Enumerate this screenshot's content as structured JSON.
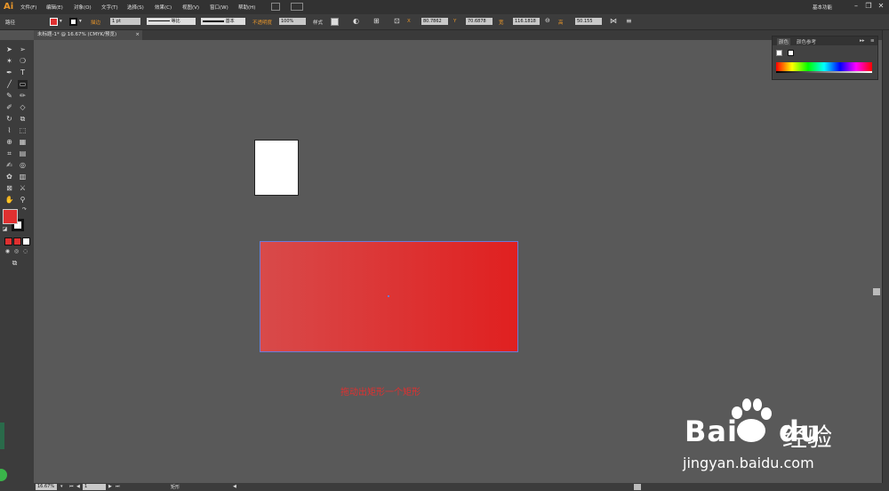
{
  "menubar": {
    "logo": "Ai",
    "items": [
      "文件(F)",
      "编辑(E)",
      "对象(O)",
      "文字(T)",
      "选择(S)",
      "效果(C)",
      "视图(V)",
      "窗口(W)",
      "帮助(H)"
    ],
    "workspace": "基本功能"
  },
  "controlbar": {
    "object_type": "路径",
    "stroke_label": "描边",
    "stroke_weight": "1 pt",
    "profile_label": "等比",
    "brush_label": "基本",
    "opacity_label": "不透明度",
    "opacity_value": "100%",
    "style_label": "样式",
    "x_label": "X",
    "x_value": "80.7862",
    "y_label": "Y",
    "y_value": "70.6878",
    "w_label": "宽",
    "w_value": "116.1818",
    "h_label": "高",
    "h_value": "50.155",
    "fill_color": "#e03030"
  },
  "document": {
    "tab_title": "未标题-1* @ 16.67% (CMYK/预览)",
    "close": "×"
  },
  "canvas": {
    "annotation": "拖动出矩形一个矩形",
    "rect_color_start": "#d84a4a",
    "rect_color_end": "#e02020"
  },
  "colorpanel": {
    "tab1": "颜色",
    "tab2": "颜色参考"
  },
  "statusbar": {
    "zoom": "16.67%",
    "artboard": "1",
    "tool": "矩形"
  },
  "watermark": {
    "brand": "Bai",
    "brand2": "du",
    "cn": "经验",
    "url": "jingyan.baidu.com"
  }
}
